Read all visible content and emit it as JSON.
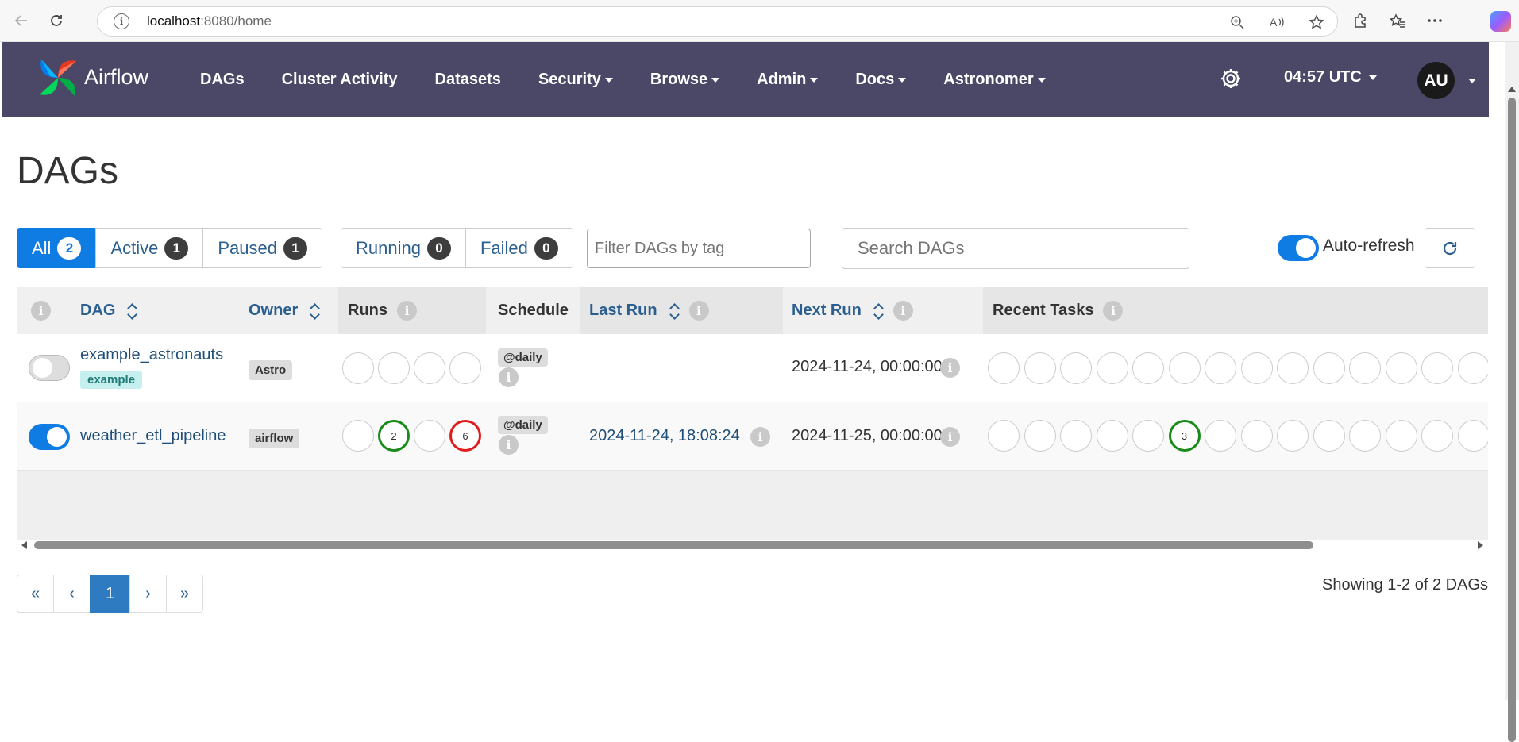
{
  "browser": {
    "url_host": "localhost",
    "url_path": ":8080/home"
  },
  "navbar": {
    "brand": "Airflow",
    "items": [
      {
        "label": "DAGs",
        "dropdown": false
      },
      {
        "label": "Cluster Activity",
        "dropdown": false
      },
      {
        "label": "Datasets",
        "dropdown": false
      },
      {
        "label": "Security",
        "dropdown": true
      },
      {
        "label": "Browse",
        "dropdown": true
      },
      {
        "label": "Admin",
        "dropdown": true
      },
      {
        "label": "Docs",
        "dropdown": true
      },
      {
        "label": "Astronomer",
        "dropdown": true
      }
    ],
    "time": "04:57 UTC",
    "avatar_initials": "AU"
  },
  "page": {
    "title": "DAGs"
  },
  "filters": {
    "status_group": [
      {
        "label": "All",
        "count": "2",
        "active": true
      },
      {
        "label": "Active",
        "count": "1",
        "active": false
      },
      {
        "label": "Paused",
        "count": "1",
        "active": false
      }
    ],
    "state_group": [
      {
        "label": "Running",
        "count": "0"
      },
      {
        "label": "Failed",
        "count": "0"
      }
    ],
    "tag_placeholder": "Filter DAGs by tag",
    "search_placeholder": "Search DAGs",
    "autorefresh_label": "Auto-refresh"
  },
  "table": {
    "headers": {
      "dag": "DAG",
      "owner": "Owner",
      "runs": "Runs",
      "schedule": "Schedule",
      "last_run": "Last Run",
      "next_run": "Next Run",
      "recent_tasks": "Recent Tasks"
    },
    "rows": [
      {
        "name": "example_astronauts",
        "tag": "example",
        "owner": "Astro",
        "paused": true,
        "runs": [
          "",
          "",
          "",
          ""
        ],
        "schedule": "@daily",
        "last_run": "",
        "next_run": "2024-11-24, 00:00:00"
      },
      {
        "name": "weather_etl_pipeline",
        "tag": "",
        "owner": "airflow",
        "paused": false,
        "runs": [
          "",
          "2",
          "",
          "6"
        ],
        "schedule": "@daily",
        "last_run": "2024-11-24, 18:08:24",
        "next_run": "2024-11-25, 00:00:00"
      }
    ],
    "row2_recent_task_count": "3"
  },
  "pagination": {
    "first": "«",
    "prev": "‹",
    "current": "1",
    "next": "›",
    "last": "»",
    "summary": "Showing 1-2 of 2 DAGs"
  },
  "colors": {
    "navbar": "#4b4867",
    "primary": "#0f7ce4",
    "success": "#1a8a1a",
    "failed": "#e01b1b"
  }
}
